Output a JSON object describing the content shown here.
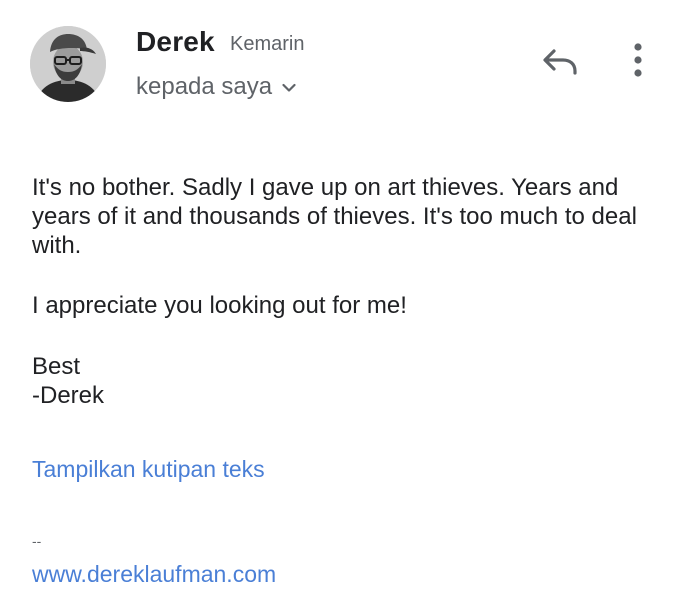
{
  "sender": {
    "name": "Derek",
    "time": "Kemarin",
    "recipient": "kepada saya"
  },
  "icons": {
    "avatar": "avatar-photo",
    "expand": "chevron-down-icon",
    "reply": "reply-icon",
    "more": "more-vert-icon"
  },
  "message": {
    "paragraph1": "It's no bother. Sadly I gave up on art thieves. Years and years of it and thousands of thieves. It's too much to deal with.",
    "paragraph2": "I appreciate you looking out for me!",
    "closing": "Best",
    "signoff": "-Derek"
  },
  "quoted_toggle": "Tampilkan kutipan teks",
  "signature": {
    "separator": "--",
    "link": "www.dereklaufman.com"
  },
  "colors": {
    "link": "#4a7fd6",
    "secondary_text": "#5f6368",
    "primary_text": "#202124"
  }
}
